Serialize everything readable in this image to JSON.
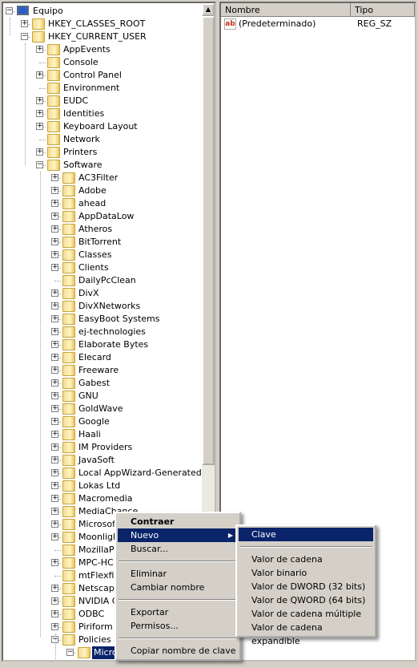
{
  "tree": {
    "rows": [
      {
        "label": "Equipo",
        "level": 0,
        "exp": "-",
        "icon": "computer"
      },
      {
        "label": "HKEY_CLASSES_ROOT",
        "level": 1,
        "exp": "+"
      },
      {
        "label": "HKEY_CURRENT_USER",
        "level": 1,
        "exp": "-"
      },
      {
        "label": "AppEvents",
        "level": 2,
        "exp": "+"
      },
      {
        "label": "Console",
        "level": 2,
        "exp": ""
      },
      {
        "label": "Control Panel",
        "level": 2,
        "exp": "+"
      },
      {
        "label": "Environment",
        "level": 2,
        "exp": ""
      },
      {
        "label": "EUDC",
        "level": 2,
        "exp": "+"
      },
      {
        "label": "Identities",
        "level": 2,
        "exp": "+"
      },
      {
        "label": "Keyboard Layout",
        "level": 2,
        "exp": "+"
      },
      {
        "label": "Network",
        "level": 2,
        "exp": ""
      },
      {
        "label": "Printers",
        "level": 2,
        "exp": "+"
      },
      {
        "label": "Software",
        "level": 2,
        "exp": "-"
      },
      {
        "label": "AC3Filter",
        "level": 3,
        "exp": "+"
      },
      {
        "label": "Adobe",
        "level": 3,
        "exp": "+"
      },
      {
        "label": "ahead",
        "level": 3,
        "exp": "+"
      },
      {
        "label": "AppDataLow",
        "level": 3,
        "exp": "+"
      },
      {
        "label": "Atheros",
        "level": 3,
        "exp": "+"
      },
      {
        "label": "BitTorrent",
        "level": 3,
        "exp": "+"
      },
      {
        "label": "Classes",
        "level": 3,
        "exp": "+"
      },
      {
        "label": "Clients",
        "level": 3,
        "exp": "+"
      },
      {
        "label": "DailyPcClean",
        "level": 3,
        "exp": ""
      },
      {
        "label": "DivX",
        "level": 3,
        "exp": "+"
      },
      {
        "label": "DivXNetworks",
        "level": 3,
        "exp": "+"
      },
      {
        "label": "EasyBoot Systems",
        "level": 3,
        "exp": "+"
      },
      {
        "label": "ej-technologies",
        "level": 3,
        "exp": "+"
      },
      {
        "label": "Elaborate Bytes",
        "level": 3,
        "exp": "+"
      },
      {
        "label": "Elecard",
        "level": 3,
        "exp": "+"
      },
      {
        "label": "Freeware",
        "level": 3,
        "exp": "+"
      },
      {
        "label": "Gabest",
        "level": 3,
        "exp": "+"
      },
      {
        "label": "GNU",
        "level": 3,
        "exp": "+"
      },
      {
        "label": "GoldWave",
        "level": 3,
        "exp": "+"
      },
      {
        "label": "Google",
        "level": 3,
        "exp": "+"
      },
      {
        "label": "Haali",
        "level": 3,
        "exp": "+"
      },
      {
        "label": "IM Providers",
        "level": 3,
        "exp": "+"
      },
      {
        "label": "JavaSoft",
        "level": 3,
        "exp": "+"
      },
      {
        "label": "Local AppWizard-Generated Applications",
        "level": 3,
        "exp": "+"
      },
      {
        "label": "Lokas Ltd",
        "level": 3,
        "exp": "+"
      },
      {
        "label": "Macromedia",
        "level": 3,
        "exp": "+"
      },
      {
        "label": "MediaChance",
        "level": 3,
        "exp": "+"
      },
      {
        "label": "Microsoft",
        "level": 3,
        "exp": "+"
      },
      {
        "label": "Moonlight",
        "level": 3,
        "exp": "+"
      },
      {
        "label": "MozillaPlugins",
        "level": 3,
        "exp": ""
      },
      {
        "label": "MPC-HC",
        "level": 3,
        "exp": "+"
      },
      {
        "label": "mtFlexfix",
        "level": 3,
        "exp": ""
      },
      {
        "label": "Netscape",
        "level": 3,
        "exp": "+"
      },
      {
        "label": "NVIDIA Corporation",
        "level": 3,
        "exp": "+"
      },
      {
        "label": "ODBC",
        "level": 3,
        "exp": "+"
      },
      {
        "label": "Piriform",
        "level": 3,
        "exp": "+"
      },
      {
        "label": "Policies",
        "level": 3,
        "exp": "-"
      },
      {
        "label": "Microsoft",
        "level": 4,
        "exp": "-",
        "selected": true
      }
    ]
  },
  "list": {
    "columns": [
      "Nombre",
      "Tipo"
    ],
    "rows": [
      {
        "name": "(Predeterminado)",
        "type": "REG_SZ",
        "icon": "string-value-icon"
      }
    ]
  },
  "context_menu": {
    "items": [
      "Contraer",
      "Nuevo",
      "Buscar...",
      "Eliminar",
      "Cambiar nombre",
      "Exportar",
      "Permisos...",
      "Copiar nombre de clave"
    ]
  },
  "submenu": {
    "items": [
      "Clave",
      "Valor de cadena",
      "Valor binario",
      "Valor de DWORD (32 bits)",
      "Valor de QWORD (64 bits)",
      "Valor de cadena múltiple",
      "Valor de cadena expandible"
    ]
  },
  "colors": {
    "highlight": "#0a246a",
    "menu_bg": "#d4d0c8"
  }
}
